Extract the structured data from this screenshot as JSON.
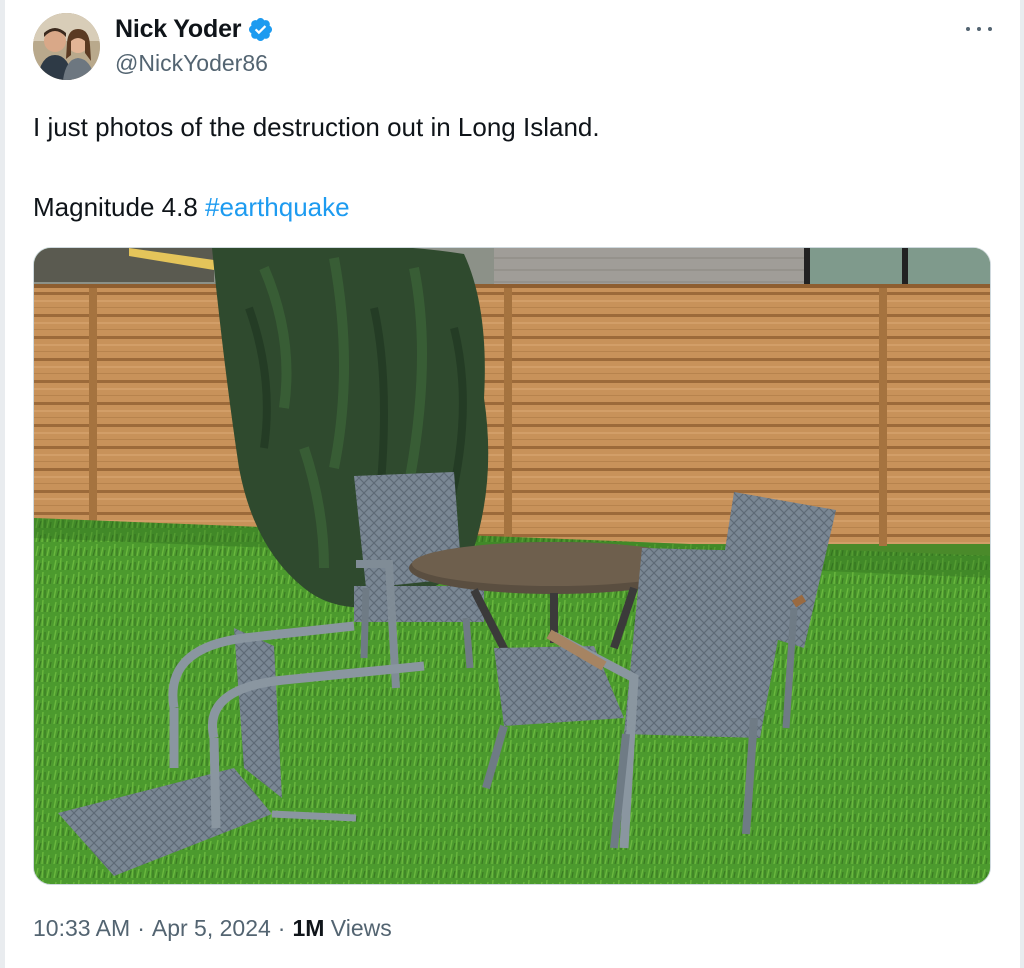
{
  "tweet": {
    "author": {
      "display_name": "Nick Yoder",
      "handle": "@NickYoder86",
      "verified": true
    },
    "text_line1": "I just photos of the destruction out in Long Island.",
    "text_line2_prefix": "Magnitude 4.8 ",
    "hashtag": "#earthquake",
    "timestamp_time": "10:33 AM",
    "separator": "·",
    "timestamp_date": "Apr 5, 2024",
    "views_count": "1M",
    "views_label": "Views"
  },
  "colors": {
    "accent": "#1d9bf0",
    "text_primary": "#0f1419",
    "text_secondary": "#536471"
  },
  "icons": {
    "verified": "verified-badge-icon",
    "more": "more-options-icon"
  }
}
